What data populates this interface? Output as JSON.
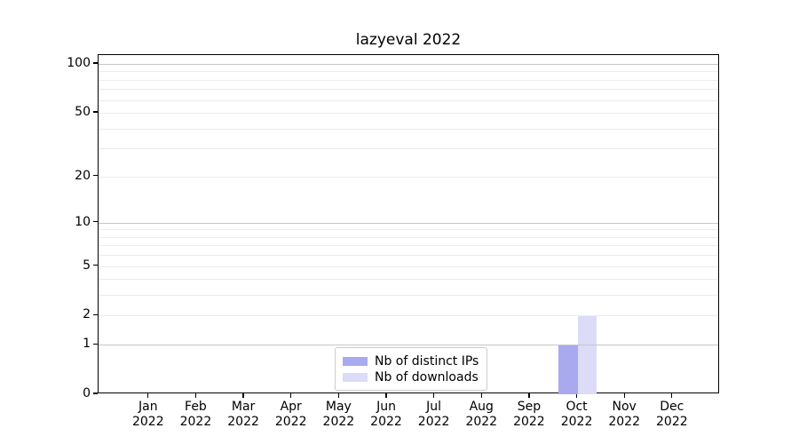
{
  "chart_data": {
    "type": "bar",
    "title": "lazyeval 2022",
    "categories": [
      "Jan 2022",
      "Feb 2022",
      "Mar 2022",
      "Apr 2022",
      "May 2022",
      "Jun 2022",
      "Jul 2022",
      "Aug 2022",
      "Sep 2022",
      "Oct 2022",
      "Nov 2022",
      "Dec 2022"
    ],
    "series": [
      {
        "name": "Nb of distinct IPs",
        "color": "#a9a9f0",
        "values": [
          0,
          0,
          0,
          0,
          0,
          0,
          0,
          0,
          0,
          1,
          0,
          0
        ]
      },
      {
        "name": "Nb of downloads",
        "color": "#dcdcf8",
        "values": [
          0,
          0,
          0,
          0,
          0,
          0,
          0,
          0,
          0,
          2,
          0,
          0
        ]
      }
    ],
    "xlabel": "",
    "ylabel": "",
    "yscale": "log1p",
    "ylim": [
      0,
      113
    ],
    "y_ticks": [
      0,
      1,
      2,
      5,
      10,
      20,
      50,
      100
    ],
    "y_major_gridlines": [
      1,
      10,
      100
    ],
    "y_minor_gridlines": [
      2,
      3,
      4,
      5,
      6,
      7,
      8,
      9,
      20,
      30,
      40,
      50,
      60,
      70,
      80,
      90
    ],
    "grid": true,
    "legend_position": "lower center",
    "colors": {
      "grid_major": "#c6c6c6",
      "grid_minor": "#ececec",
      "axis": "#000000",
      "background": "#ffffff"
    }
  }
}
